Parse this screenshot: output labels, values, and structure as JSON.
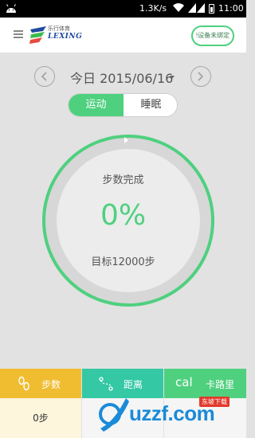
{
  "status_bar": {
    "speed": "1.3K/s",
    "time": "11:00",
    "icons": [
      "android-icon",
      "wifi-icon",
      "signal-icon",
      "signal-icon",
      "battery-icon"
    ]
  },
  "header": {
    "logo_sub": "乐行体育",
    "logo_main": "LEXING",
    "device_status": "!设备未绑定"
  },
  "date_nav": {
    "date": "今日 2015/06/16"
  },
  "mode_toggle": {
    "options": [
      "运动",
      "睡眠"
    ],
    "selected": "运动"
  },
  "progress": {
    "title": "步数完成",
    "percent_text": "0%",
    "percent_value": 0,
    "goal": "目标12000步"
  },
  "tabs": [
    {
      "label": "步数",
      "value": "0步",
      "icon": "steps-icon",
      "color": "#f0bd31"
    },
    {
      "label": "距离",
      "value": "",
      "icon": "distance-icon",
      "color": "#34c8a5"
    },
    {
      "label": "卡路里",
      "value": "",
      "icon": "calorie-icon",
      "cal_text": "cal",
      "color": "#4fd07f"
    }
  ],
  "watermark": {
    "domain": "uzzf.com",
    "cn": "东坡下载"
  },
  "colors": {
    "accent": "#4fd07f",
    "background": "#e2e2e2"
  }
}
